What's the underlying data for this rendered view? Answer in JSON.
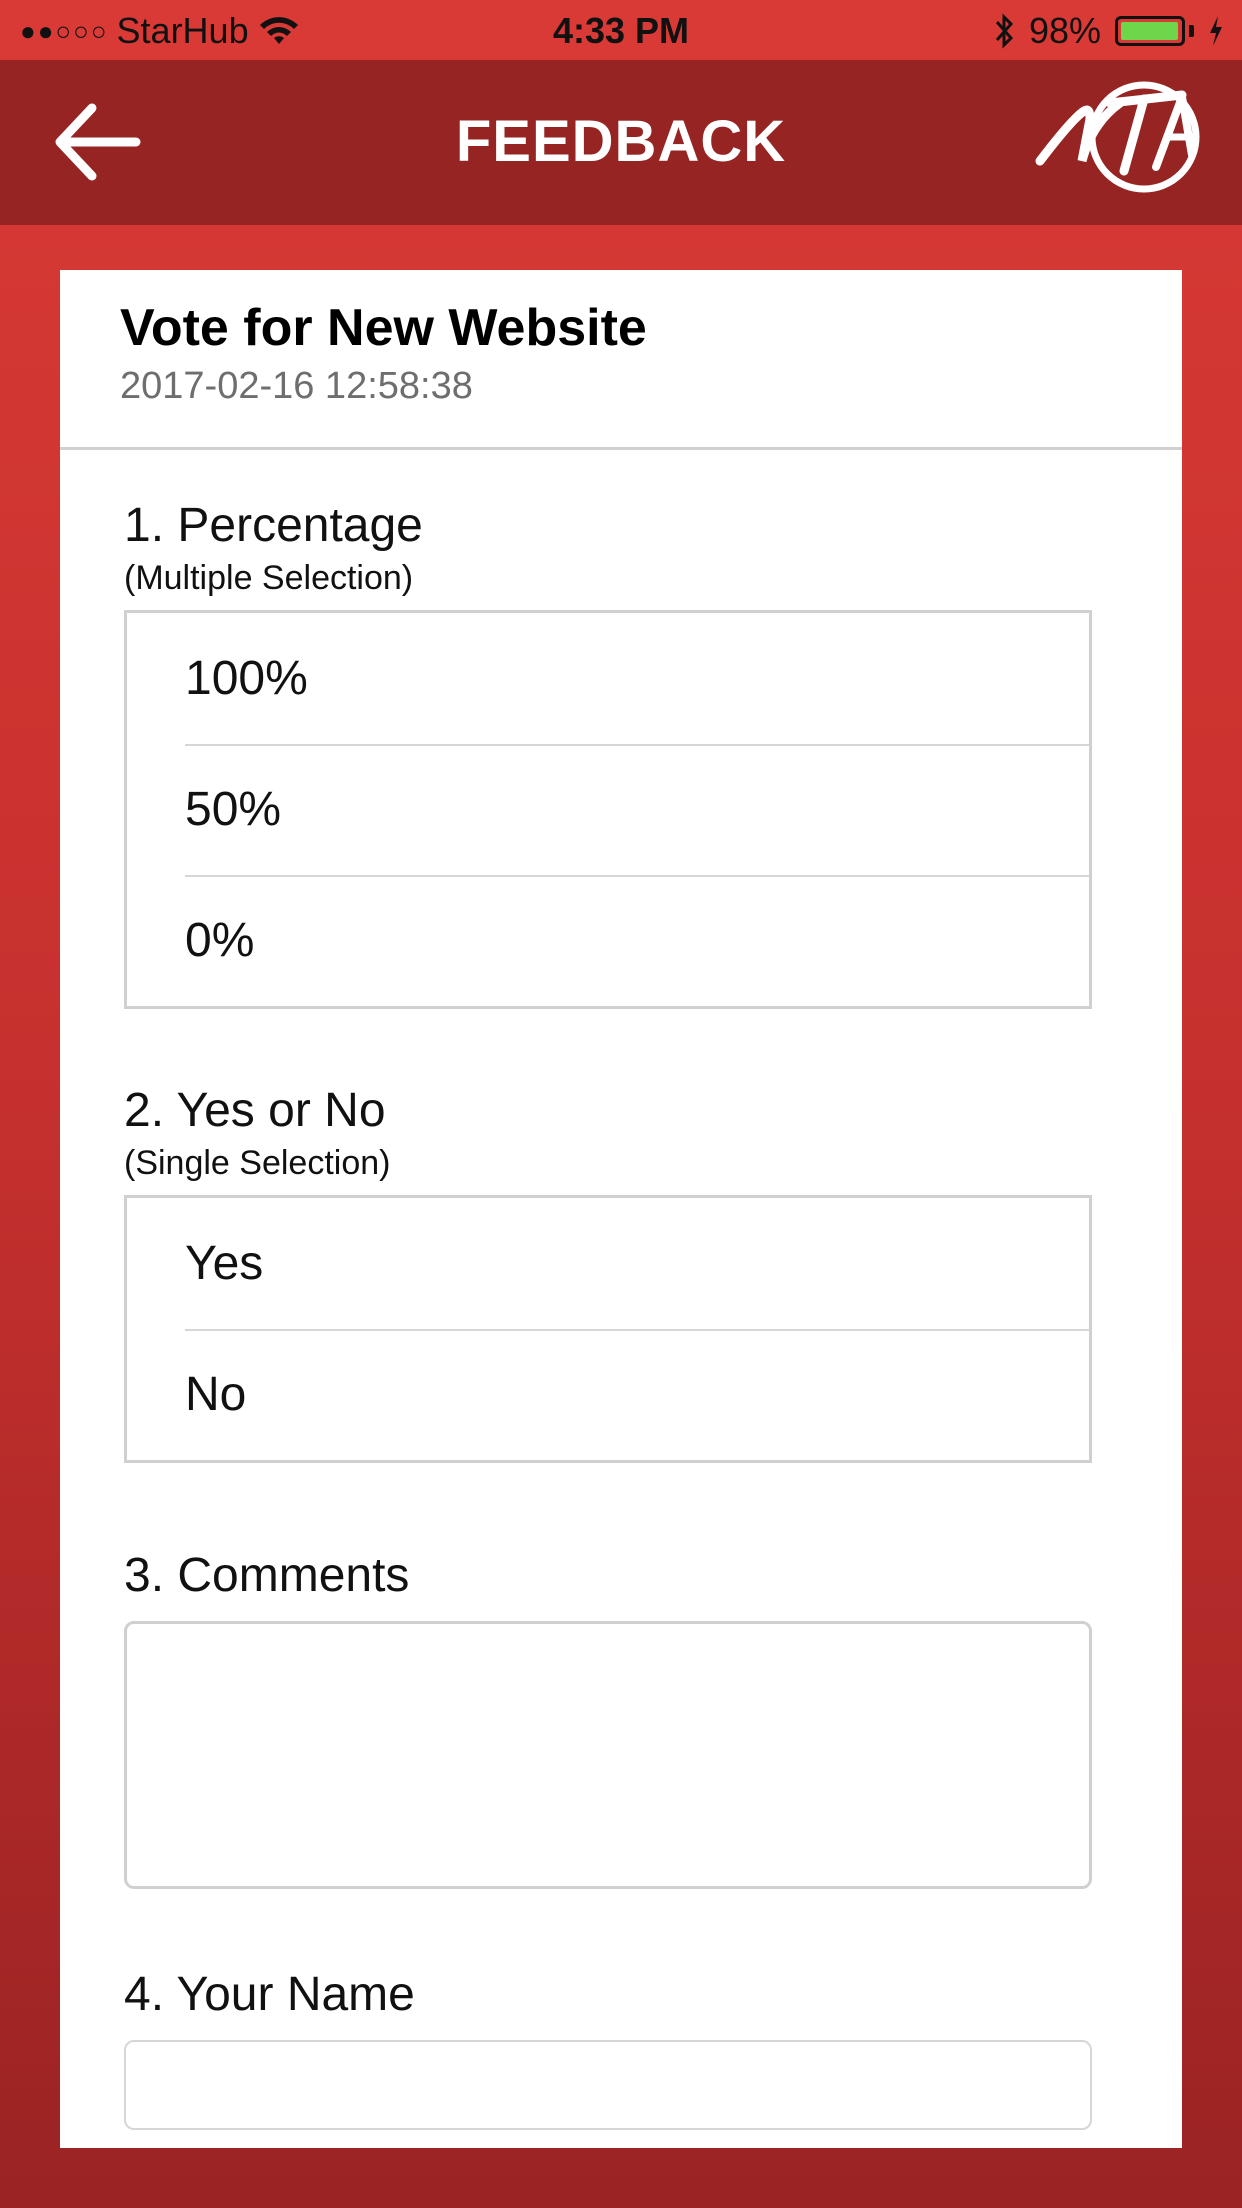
{
  "status_bar": {
    "signal": "●●○○○",
    "carrier": "StarHub",
    "time": "4:33 PM",
    "battery": "98%",
    "battery_level": 0.98
  },
  "nav": {
    "title": "FEEDBACK"
  },
  "survey": {
    "title": "Vote for New Website",
    "date": "2017-02-16 12:58:38"
  },
  "questions": [
    {
      "title": "1. Percentage",
      "subtitle": "(Multiple Selection)",
      "options": [
        "100%",
        "50%",
        "0%"
      ]
    },
    {
      "title": "2. Yes or No",
      "subtitle": "(Single Selection)",
      "options": [
        "Yes",
        "No"
      ]
    },
    {
      "title": "3. Comments",
      "value": ""
    },
    {
      "title": "4. Your Name",
      "value": ""
    }
  ]
}
